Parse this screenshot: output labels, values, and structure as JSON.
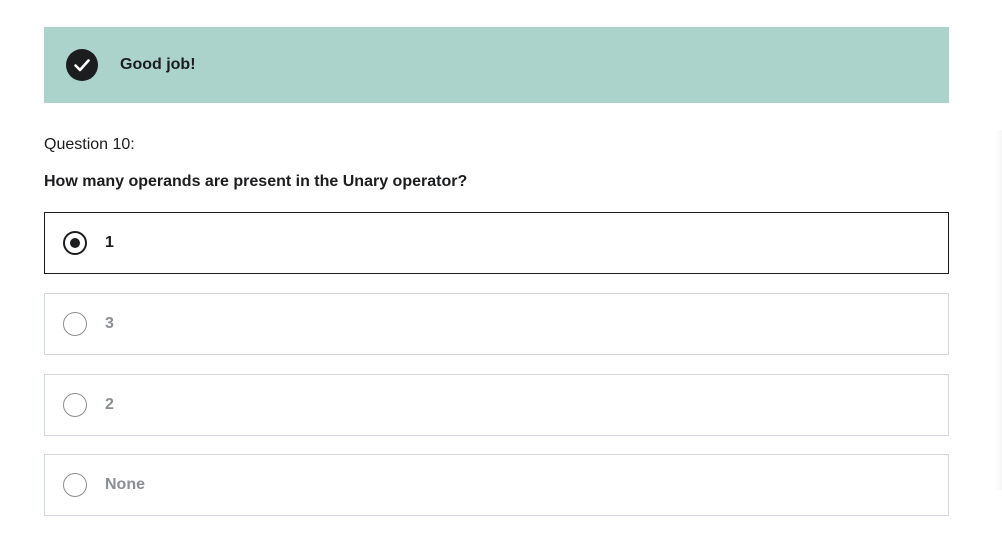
{
  "feedback": {
    "icon": "check-circle-icon",
    "message": "Good job!",
    "color": "#acd2cc"
  },
  "question": {
    "number_label": "Question 10:",
    "prompt": "How many operands are present in the Unary operator?"
  },
  "options": [
    {
      "label": "1",
      "selected": true
    },
    {
      "label": "3",
      "selected": false
    },
    {
      "label": "2",
      "selected": false
    },
    {
      "label": "None",
      "selected": false
    }
  ]
}
